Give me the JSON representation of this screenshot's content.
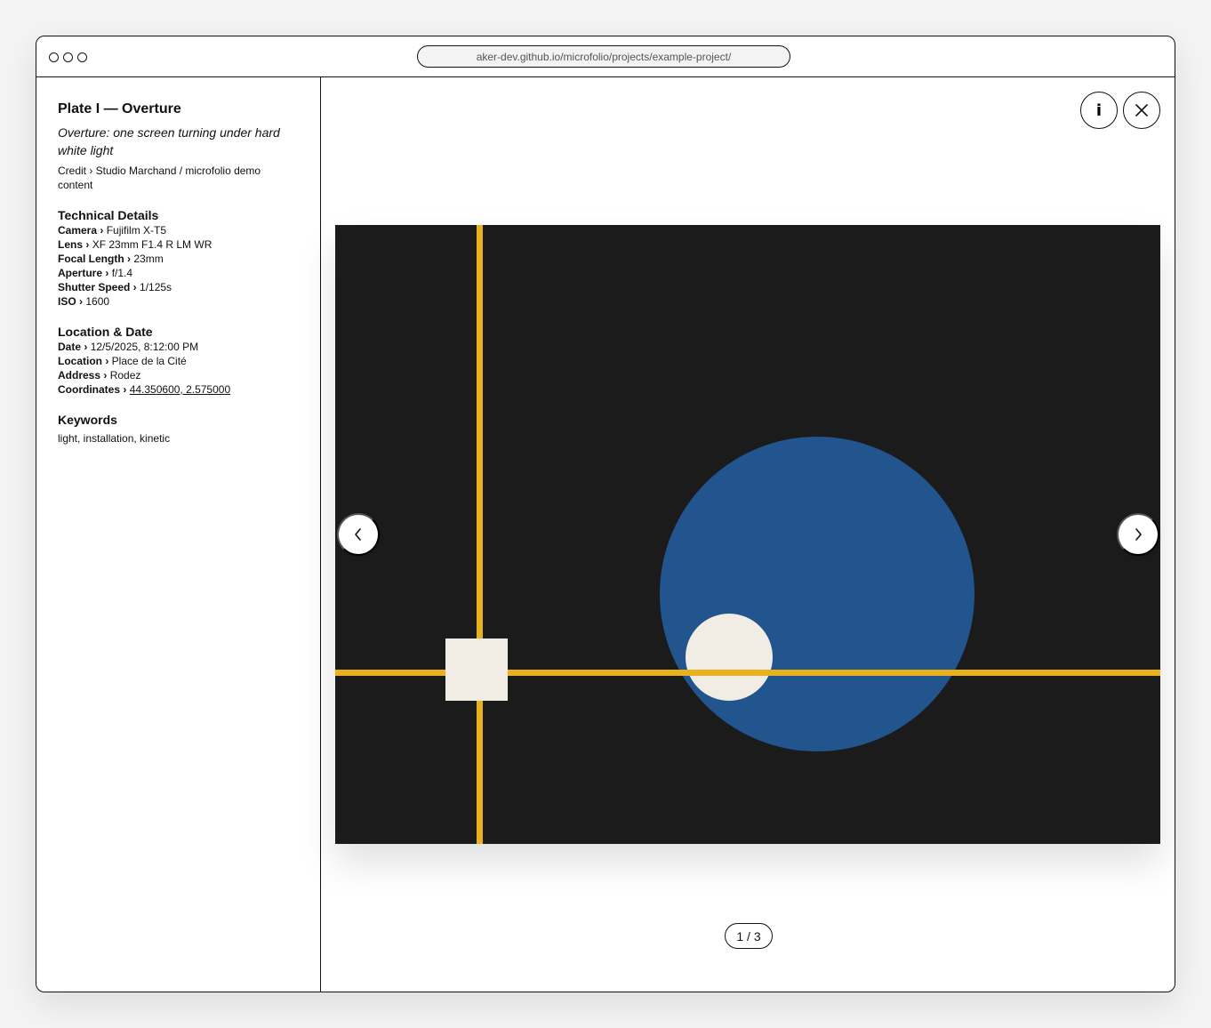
{
  "browser": {
    "url": "aker-dev.github.io/microfolio/projects/example-project/"
  },
  "sidebar": {
    "title": "Plate I — Overture",
    "subtitle": "Overture: one screen turning under hard white light",
    "credit": "Credit › Studio Marchand / microfolio demo content",
    "technical": {
      "heading": "Technical Details",
      "camera_label": "Camera ›",
      "camera": "Fujifilm X-T5",
      "lens_label": "Lens ›",
      "lens": "XF 23mm F1.4 R LM WR",
      "focal_label": "Focal Length ›",
      "focal": "23mm",
      "aperture_label": "Aperture ›",
      "aperture": "f/1.4",
      "shutter_label": "Shutter Speed ›",
      "shutter": "1/125s",
      "iso_label": "ISO ›",
      "iso": "1600"
    },
    "location": {
      "heading": "Location & Date",
      "date_label": "Date ›",
      "date": "12/5/2025, 8:12:00 PM",
      "location_label": "Location ›",
      "location": "Place de la Cité",
      "address_label": "Address ›",
      "address": "Rodez",
      "coords_label": "Coordinates ›",
      "coords": "44.350600, 2.575000"
    },
    "keywords": {
      "heading": "Keywords",
      "value": "light, installation, kinetic"
    }
  },
  "viewer": {
    "counter": "1 / 3",
    "colors": {
      "background": "#1b1b1b",
      "line": "#e8b21e",
      "circle_large": "#22548d",
      "cream": "#f1ece4"
    },
    "icons": {
      "info": "info-icon",
      "close": "close-icon",
      "prev": "chevron-left-icon",
      "next": "chevron-right-icon"
    },
    "info_glyph": "i"
  }
}
